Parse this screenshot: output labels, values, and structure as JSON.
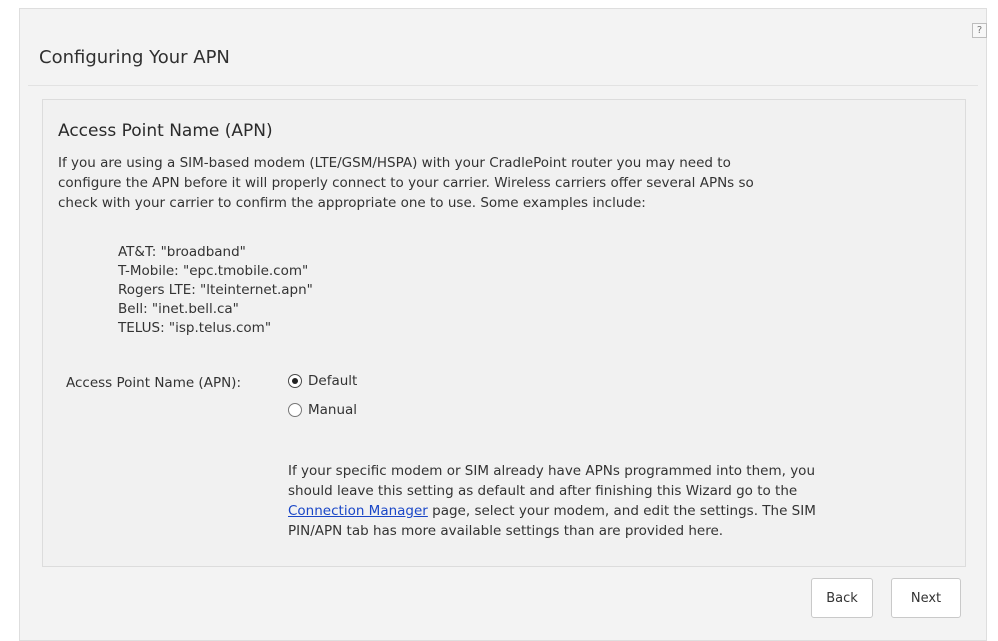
{
  "wizard": {
    "title": "Configuring Your APN",
    "help_icon": "?"
  },
  "section": {
    "heading": "Access Point Name (APN)",
    "intro_lines": [
      "If you are using a SIM-based modem (LTE/GSM/HSPA) with your CradlePoint router you may need to",
      "configure the APN before it will properly connect to your carrier. Wireless carriers offer several APNs so",
      "check with your carrier to confirm the appropriate one to use. Some examples include:"
    ],
    "examples": [
      "AT&T: \"broadband\"",
      "T-Mobile: \"epc.tmobile.com\"",
      "Rogers LTE: \"lteinternet.apn\"",
      "Bell: \"inet.bell.ca\"",
      "TELUS: \"isp.telus.com\""
    ],
    "apn_label": "Access Point Name (APN):",
    "options": [
      {
        "label": "Default",
        "selected": true
      },
      {
        "label": "Manual",
        "selected": false
      }
    ],
    "note": {
      "line1": "If your specific modem or SIM already have APNs programmed into them, you",
      "line2": "should leave this setting as default and after finishing this Wizard go to the",
      "link": "Connection Manager",
      "line3_after_link": " page, select your modem, and edit the settings. The SIM",
      "line4": "PIN/APN tab has more available settings than are provided here."
    }
  },
  "buttons": {
    "back": "Back",
    "next": "Next"
  },
  "colors": {
    "panel_background": "#f3f3f3",
    "link": "#1a47c7"
  }
}
